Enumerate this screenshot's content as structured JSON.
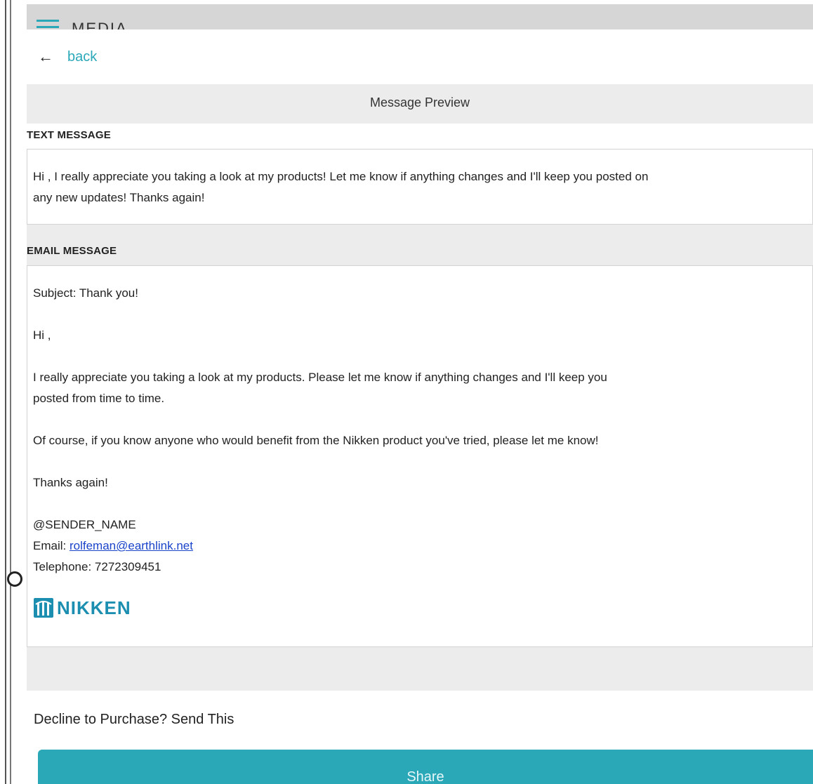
{
  "header": {
    "title": "MEDIA",
    "menu_icon": "hamburger-menu-icon"
  },
  "nav": {
    "back_label": "back",
    "back_icon": "arrow-left-icon"
  },
  "preview": {
    "title": "Message Preview"
  },
  "text_message": {
    "label": "TEXT MESSAGE",
    "body_line1": "Hi , I really appreciate you taking a look at my products! Let me know if anything changes and I'll keep you posted on",
    "body_line2": "any new updates! Thanks again!"
  },
  "email_message": {
    "label": "EMAIL MESSAGE",
    "subject": "Subject: Thank you!",
    "greeting": "Hi ,",
    "para1_line1": "I really appreciate you taking a look at my products. Please let me know if anything changes and I'll keep you",
    "para1_line2": "posted from time to time.",
    "para2": "Of course, if you know anyone who would benefit from the Nikken product you've tried, please let me know!",
    "closing": "Thanks again!",
    "sender": "@SENDER_NAME",
    "email_prefix": "Email: ",
    "email": "rolfeman@earthlink.net",
    "telephone": "Telephone: 7272309451",
    "logo_text": "NIKKEN"
  },
  "footer": {
    "decline_text": "Decline to Purchase? Send This",
    "share_label": "Share"
  },
  "colors": {
    "accent": "#2aa8b8",
    "link": "#1a44c9",
    "logo": "#1c8fb0",
    "panel_bg": "#ececec"
  }
}
